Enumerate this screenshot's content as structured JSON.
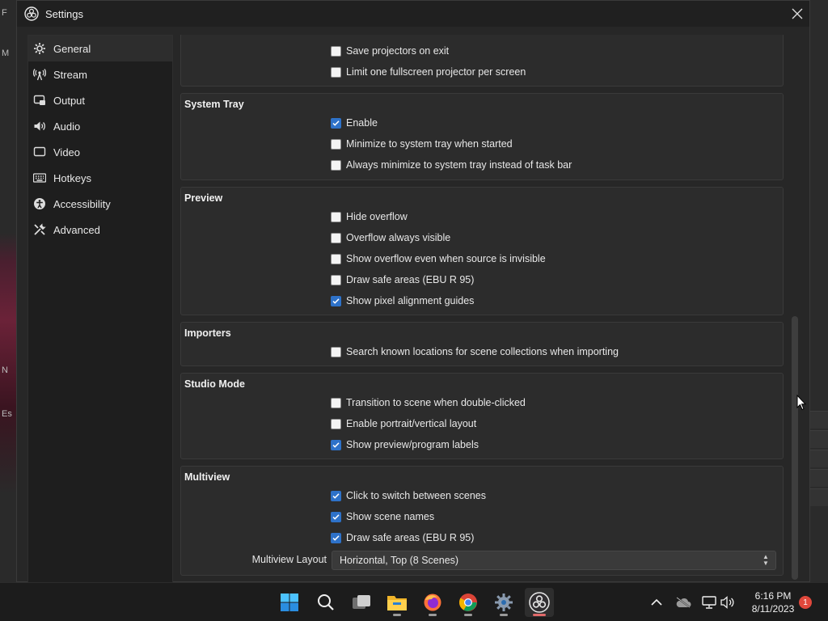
{
  "background": {
    "left_texts": [
      "F",
      "M",
      "N",
      "Es"
    ]
  },
  "window": {
    "title": "Settings",
    "close_icon": "close-icon"
  },
  "sidebar": {
    "items": [
      {
        "label": "General",
        "icon": "gear-icon",
        "active": true
      },
      {
        "label": "Stream",
        "icon": "antenna-icon",
        "active": false
      },
      {
        "label": "Output",
        "icon": "output-icon",
        "active": false
      },
      {
        "label": "Audio",
        "icon": "speaker-icon",
        "active": false
      },
      {
        "label": "Video",
        "icon": "monitor-icon",
        "active": false
      },
      {
        "label": "Hotkeys",
        "icon": "keyboard-icon",
        "active": false
      },
      {
        "label": "Accessibility",
        "icon": "accessibility-icon",
        "active": false
      },
      {
        "label": "Advanced",
        "icon": "wrench-icon",
        "active": false
      }
    ]
  },
  "groups": {
    "projectors": {
      "items": [
        {
          "label": "Save projectors on exit",
          "checked": false
        },
        {
          "label": "Limit one fullscreen projector per screen",
          "checked": false
        }
      ]
    },
    "system_tray": {
      "title": "System Tray",
      "items": [
        {
          "label": "Enable",
          "checked": true
        },
        {
          "label": "Minimize to system tray when started",
          "checked": false
        },
        {
          "label": "Always minimize to system tray instead of task bar",
          "checked": false
        }
      ]
    },
    "preview": {
      "title": "Preview",
      "items": [
        {
          "label": "Hide overflow",
          "checked": false
        },
        {
          "label": "Overflow always visible",
          "checked": false
        },
        {
          "label": "Show overflow even when source is invisible",
          "checked": false
        },
        {
          "label": "Draw safe areas (EBU R 95)",
          "checked": false
        },
        {
          "label": "Show pixel alignment guides",
          "checked": true
        }
      ]
    },
    "importers": {
      "title": "Importers",
      "items": [
        {
          "label": "Search known locations for scene collections when importing",
          "checked": false
        }
      ]
    },
    "studio_mode": {
      "title": "Studio Mode",
      "items": [
        {
          "label": "Transition to scene when double-clicked",
          "checked": false
        },
        {
          "label": "Enable portrait/vertical layout",
          "checked": false
        },
        {
          "label": "Show preview/program labels",
          "checked": true
        }
      ]
    },
    "multiview": {
      "title": "Multiview",
      "items": [
        {
          "label": "Click to switch between scenes",
          "checked": true
        },
        {
          "label": "Show scene names",
          "checked": true
        },
        {
          "label": "Draw safe areas (EBU R 95)",
          "checked": true
        }
      ],
      "layout_label": "Multiview Layout",
      "layout_value": "Horizontal, Top (8 Scenes)"
    }
  },
  "taskbar": {
    "apps": [
      {
        "name": "start-button",
        "icon": "windows-icon"
      },
      {
        "name": "search-button",
        "icon": "search-icon"
      },
      {
        "name": "task-view-button",
        "icon": "task-view-icon"
      },
      {
        "name": "file-explorer-button",
        "icon": "folder-icon"
      },
      {
        "name": "firefox-button",
        "icon": "firefox-icon"
      },
      {
        "name": "chrome-button",
        "icon": "chrome-icon"
      },
      {
        "name": "settings-app-button",
        "icon": "settings-gear-icon"
      },
      {
        "name": "obs-button",
        "icon": "obs-icon"
      }
    ],
    "time": "6:16 PM",
    "date": "8/11/2023",
    "notification_count": "1"
  }
}
